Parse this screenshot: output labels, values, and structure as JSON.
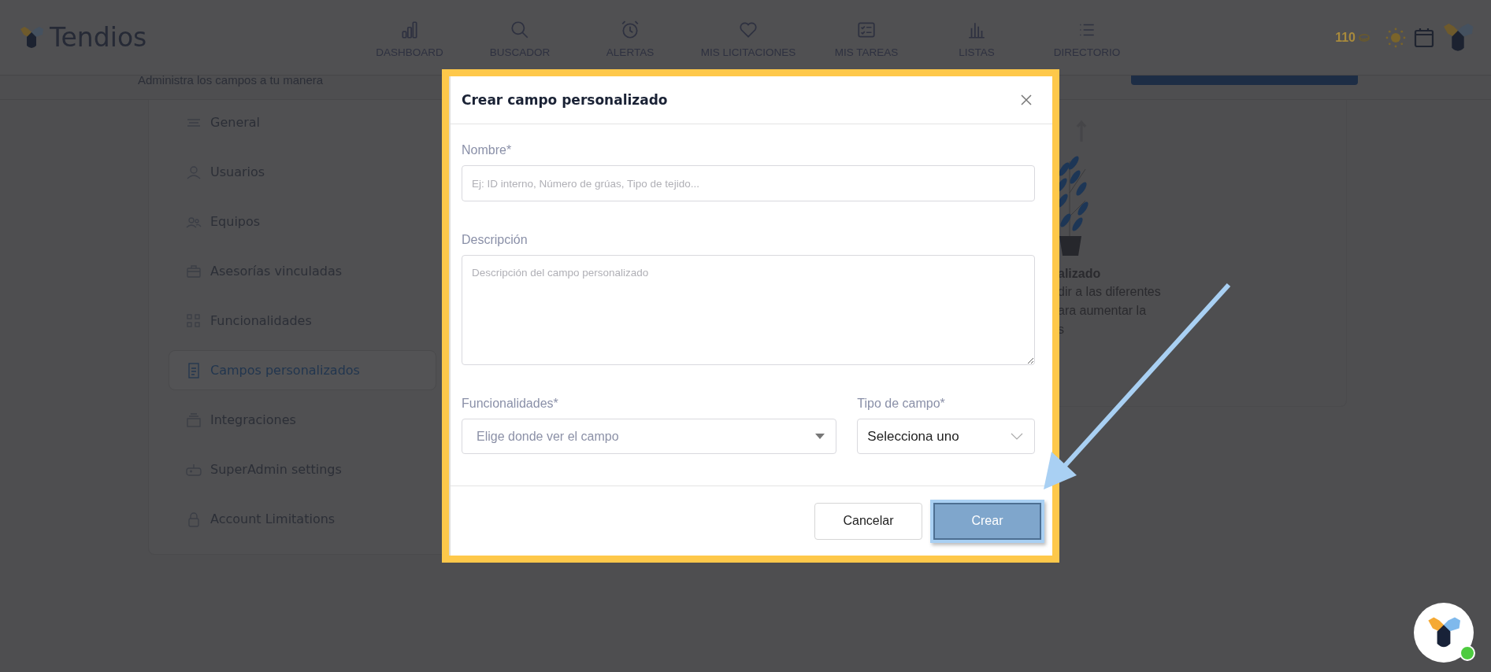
{
  "app": {
    "brand": "Tendios",
    "credits": "110",
    "nav": [
      {
        "label": "DASHBOARD"
      },
      {
        "label": "BUSCADOR"
      },
      {
        "label": "ALERTAS"
      },
      {
        "label": "MIS LICITACIONES"
      },
      {
        "label": "MIS TAREAS"
      },
      {
        "label": "LISTAS"
      },
      {
        "label": "DIRECTORIO"
      }
    ]
  },
  "page": {
    "subtitle": "Administra los campos a tu manera",
    "settings_menu": [
      {
        "label": "General",
        "selected": false
      },
      {
        "label": "Usuarios",
        "selected": false
      },
      {
        "label": "Equipos",
        "selected": false
      },
      {
        "label": "Asesorías vinculadas",
        "selected": false
      },
      {
        "label": "Funcionalidades",
        "selected": false
      },
      {
        "label": "Campos personalizados",
        "selected": true
      },
      {
        "label": "Integraciones",
        "selected": false
      },
      {
        "label": "SuperAdmin settings",
        "selected": false
      },
      {
        "label": "Account Limitations",
        "selected": false
      }
    ],
    "info_card": {
      "title": "alizado",
      "lines": [
        "dir a las diferentes",
        "ara aumentar la",
        "s"
      ]
    }
  },
  "dialog": {
    "title": "Crear campo personalizado",
    "fields": [
      {
        "kind": "text",
        "label": "Nombre*",
        "placeholder": "Ej: ID interno, Número de grúas, Tipo de tejido..."
      },
      {
        "kind": "textarea",
        "label": "Descripción",
        "placeholder": "Descripción del campo personalizado"
      }
    ],
    "selects": [
      {
        "kind": "dropdown",
        "label": "Funcionalidades*",
        "placeholder": "Elige donde ver el campo"
      },
      {
        "kind": "select",
        "label": "Tipo de campo*",
        "value": "Selecciona uno"
      }
    ],
    "buttons": [
      {
        "kind": "secondary",
        "label": "Cancelar",
        "disabled": false,
        "highlighted": false
      },
      {
        "kind": "primary",
        "label": "Crear",
        "disabled": true,
        "highlighted": true
      }
    ]
  }
}
